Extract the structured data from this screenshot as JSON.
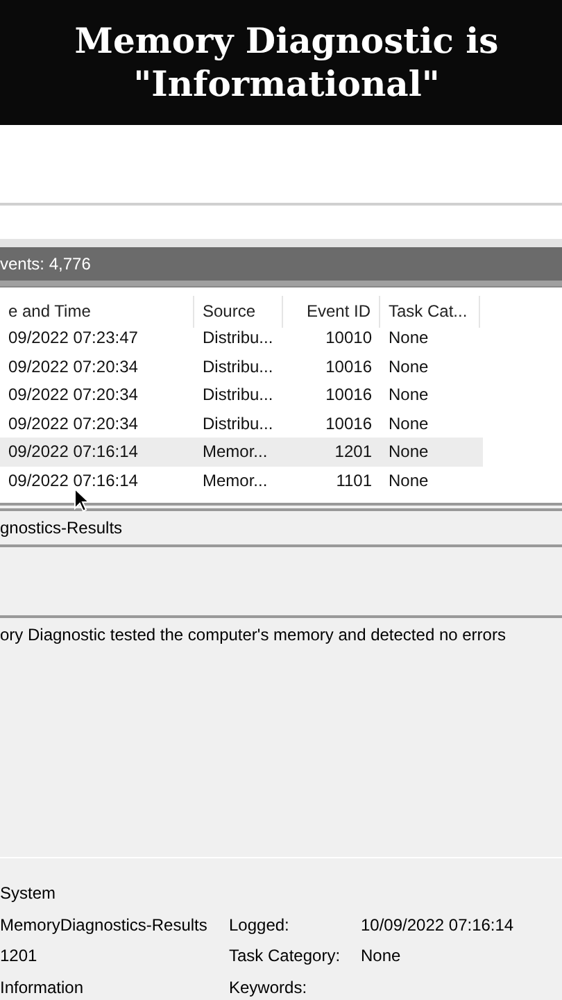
{
  "caption": {
    "lines": [
      "Memory Diagnostic is",
      "\"Informational\""
    ]
  },
  "events_bar": {
    "label": "vents: 4,776"
  },
  "table": {
    "columns": [
      "e and Time",
      "Source",
      "Event ID",
      "Task Cat..."
    ],
    "rows": [
      {
        "cells": [
          "09/2022 07:23:47",
          "Distribu...",
          "10010",
          "None"
        ],
        "selected": false
      },
      {
        "cells": [
          "09/2022 07:20:34",
          "Distribu...",
          "10016",
          "None"
        ],
        "selected": false
      },
      {
        "cells": [
          "09/2022 07:20:34",
          "Distribu...",
          "10016",
          "None"
        ],
        "selected": false
      },
      {
        "cells": [
          "09/2022 07:20:34",
          "Distribu...",
          "10016",
          "None"
        ],
        "selected": false
      },
      {
        "cells": [
          "09/2022 07:16:14",
          "Memor...",
          "1201",
          "None"
        ],
        "selected": true
      },
      {
        "cells": [
          "09/2022 07:16:14",
          "Memor...",
          "1101",
          "None"
        ],
        "selected": false
      }
    ]
  },
  "detail": {
    "header": "gnostics-Results",
    "description": "ory Diagnostic tested the computer's memory and detected no errors",
    "fields": [
      {
        "value": "System"
      },
      {
        "value": "MemoryDiagnostics-Results",
        "label": "Logged:",
        "extra": "10/09/2022 07:16:14"
      },
      {
        "value": "1201",
        "label": "Task Category:",
        "extra": "None"
      },
      {
        "value": "Information",
        "label": "Keywords:"
      }
    ]
  }
}
